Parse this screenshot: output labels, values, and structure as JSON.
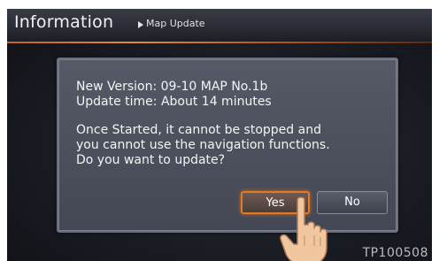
{
  "header": {
    "title": "Information",
    "breadcrumb": "Map Update"
  },
  "dialog": {
    "line1": "New Version:  09-10 MAP No.1b",
    "line2": "Update time:  About 14 minutes",
    "line3": "Once Started, it cannot be stopped and",
    "line4": "you cannot use the navigation functions.",
    "line5": "Do you want to update?",
    "yes_label": "Yes",
    "no_label": "No"
  },
  "footer": {
    "code": "TP100508"
  },
  "colors": {
    "accent": "#e07a26",
    "background": "#1a1c24",
    "dialog": "#4b4f5b",
    "text": "#f4f4f4"
  },
  "icons": {
    "pointer": "pointing-hand-icon",
    "breadcrumb_separator": "triangle-right-icon"
  }
}
